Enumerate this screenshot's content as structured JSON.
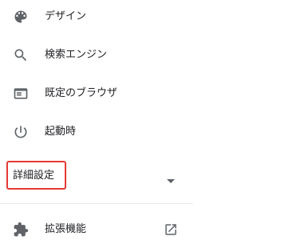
{
  "sidebar": {
    "items": [
      {
        "label": "デザイン",
        "icon": "palette-icon"
      },
      {
        "label": "検索エンジン",
        "icon": "search-icon"
      },
      {
        "label": "既定のブラウザ",
        "icon": "browser-window-icon"
      },
      {
        "label": "起動時",
        "icon": "power-icon"
      }
    ],
    "advanced": {
      "label": "詳細設定",
      "icon": "chevron-down-icon",
      "highlight_color": "#e53935"
    },
    "extensions": {
      "label": "拡張機能",
      "icon": "puzzle-icon",
      "trailing_icon": "open-in-new-icon"
    }
  }
}
